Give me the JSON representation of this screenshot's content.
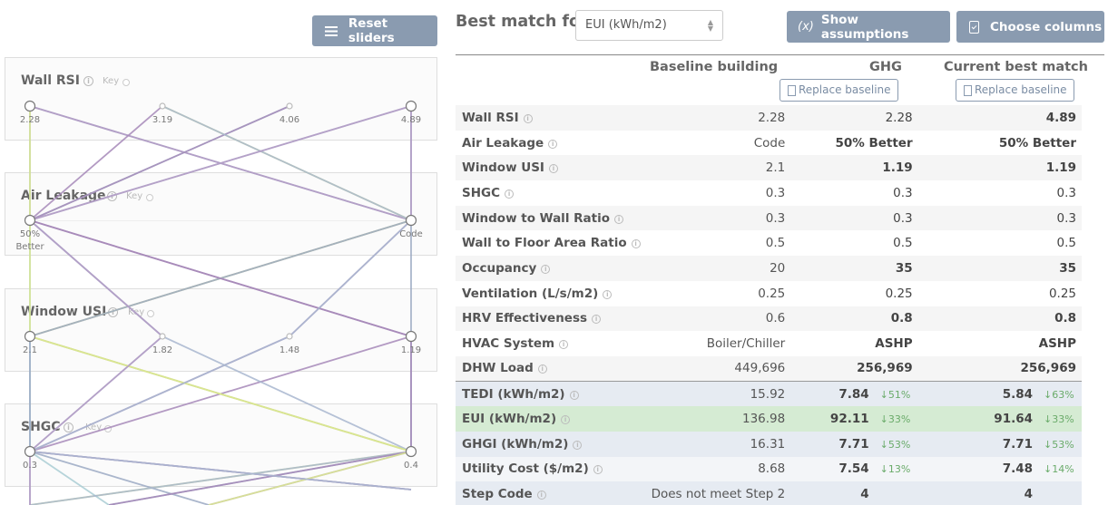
{
  "left": {
    "reset_label": "Reset sliders",
    "key_label": "Key",
    "axes": [
      {
        "title": "Wall RSI",
        "ticks": [
          "2.28",
          "3.19",
          "4.06",
          "4.89"
        ]
      },
      {
        "title": "Air Leakage",
        "ticks": [
          "50%\nBetter",
          "Code"
        ]
      },
      {
        "title": "Window USI",
        "ticks": [
          "2.1",
          "1.82",
          "1.48",
          "1.19"
        ]
      },
      {
        "title": "SHGC",
        "ticks": [
          "0.3",
          "0.4"
        ]
      }
    ],
    "line_colors": [
      "#a8b6cf",
      "#9ba9c3",
      "#b59bc6",
      "#a688b8",
      "#d9e88e",
      "#a9cdd3"
    ]
  },
  "right": {
    "best_match_label": "Best match for",
    "metric_value": "EUI (kWh/m2)",
    "assumptions_label": "Show assumptions",
    "assumptions_icon": "(x)",
    "columns_label": "Choose columns",
    "col_baseline": "Baseline building",
    "col_ghg": "GHG",
    "col_current": "Current best match",
    "replace_label": "Replace baseline",
    "info_glyph": "i",
    "rows": [
      {
        "name": "Wall RSI",
        "base": "2.28",
        "ghg": "2.28",
        "ghg_b": false,
        "cur": "4.89",
        "cur_b": true
      },
      {
        "name": "Air Leakage",
        "base": "Code",
        "ghg": "50% Better",
        "ghg_b": true,
        "cur": "50% Better",
        "cur_b": true
      },
      {
        "name": "Window USI",
        "base": "2.1",
        "ghg": "1.19",
        "ghg_b": true,
        "cur": "1.19",
        "cur_b": true
      },
      {
        "name": "SHGC",
        "base": "0.3",
        "ghg": "0.3",
        "ghg_b": false,
        "cur": "0.3",
        "cur_b": false
      },
      {
        "name": "Window to Wall Ratio",
        "base": "0.3",
        "ghg": "0.3",
        "ghg_b": false,
        "cur": "0.3",
        "cur_b": false
      },
      {
        "name": "Wall to Floor Area Ratio",
        "base": "0.5",
        "ghg": "0.5",
        "ghg_b": false,
        "cur": "0.5",
        "cur_b": false
      },
      {
        "name": "Occupancy",
        "base": "20",
        "ghg": "35",
        "ghg_b": true,
        "cur": "35",
        "cur_b": true
      },
      {
        "name": "Ventilation (L/s/m2)",
        "base": "0.25",
        "ghg": "0.25",
        "ghg_b": false,
        "cur": "0.25",
        "cur_b": false
      },
      {
        "name": "HRV Effectiveness",
        "base": "0.6",
        "ghg": "0.8",
        "ghg_b": true,
        "cur": "0.8",
        "cur_b": true
      },
      {
        "name": "HVAC System",
        "base": "Boiler/Chiller",
        "ghg": "ASHP",
        "ghg_b": true,
        "cur": "ASHP",
        "cur_b": true
      },
      {
        "name": "DHW Load",
        "base": "449,696",
        "ghg": "256,969",
        "ghg_b": true,
        "cur": "256,969",
        "cur_b": true
      }
    ],
    "results": [
      {
        "name": "TEDI (kWh/m2)",
        "base": "15.92",
        "ghg": "7.84",
        "ghg_pct": "↓51%",
        "cur": "5.84",
        "cur_pct": "↓63%"
      },
      {
        "name": "EUI (kWh/m2)",
        "base": "136.98",
        "ghg": "92.11",
        "ghg_pct": "↓33%",
        "cur": "91.64",
        "cur_pct": "↓33%"
      },
      {
        "name": "GHGI (kWh/m2)",
        "base": "16.31",
        "ghg": "7.71",
        "ghg_pct": "↓53%",
        "cur": "7.71",
        "cur_pct": "↓53%"
      },
      {
        "name": "Utility Cost ($/m2)",
        "base": "8.68",
        "ghg": "7.54",
        "ghg_pct": "↓13%",
        "cur": "7.48",
        "cur_pct": "↓14%"
      },
      {
        "name": "Step Code",
        "base": "Does not meet Step 2",
        "ghg": "4",
        "ghg_pct": "",
        "cur": "4",
        "cur_pct": ""
      }
    ],
    "highlight_color": "#d5ebd3",
    "button_color": "#8a9bb0"
  }
}
